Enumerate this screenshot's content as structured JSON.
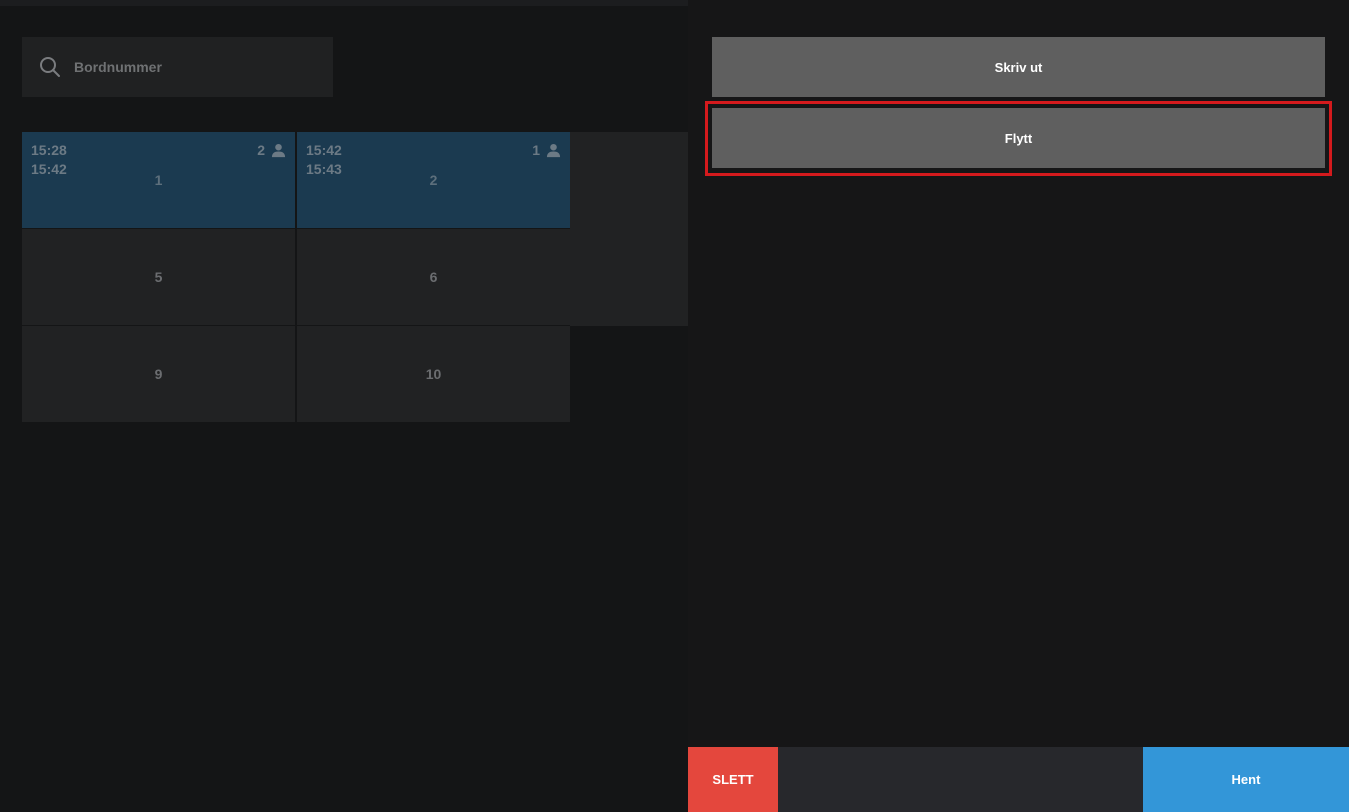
{
  "search": {
    "placeholder": "Bordnummer"
  },
  "tables": [
    {
      "number": "1",
      "start": "15:28",
      "end": "15:42",
      "guests": "2",
      "occupied": true
    },
    {
      "number": "2",
      "start": "15:42",
      "end": "15:43",
      "guests": "1",
      "occupied": true
    },
    {
      "number": "5",
      "occupied": false
    },
    {
      "number": "6",
      "occupied": false
    },
    {
      "number": "9",
      "occupied": false
    },
    {
      "number": "10",
      "occupied": false
    }
  ],
  "actions": {
    "print_label": "Skriv ut",
    "move_label": "Flytt"
  },
  "footer": {
    "delete_label": "SLETT",
    "fetch_label": "Hent"
  },
  "colors": {
    "occupied": "#1b3a50",
    "free": "#212223",
    "delete": "#e4473d",
    "fetch": "#3396d8",
    "highlight": "#d41a1d"
  }
}
